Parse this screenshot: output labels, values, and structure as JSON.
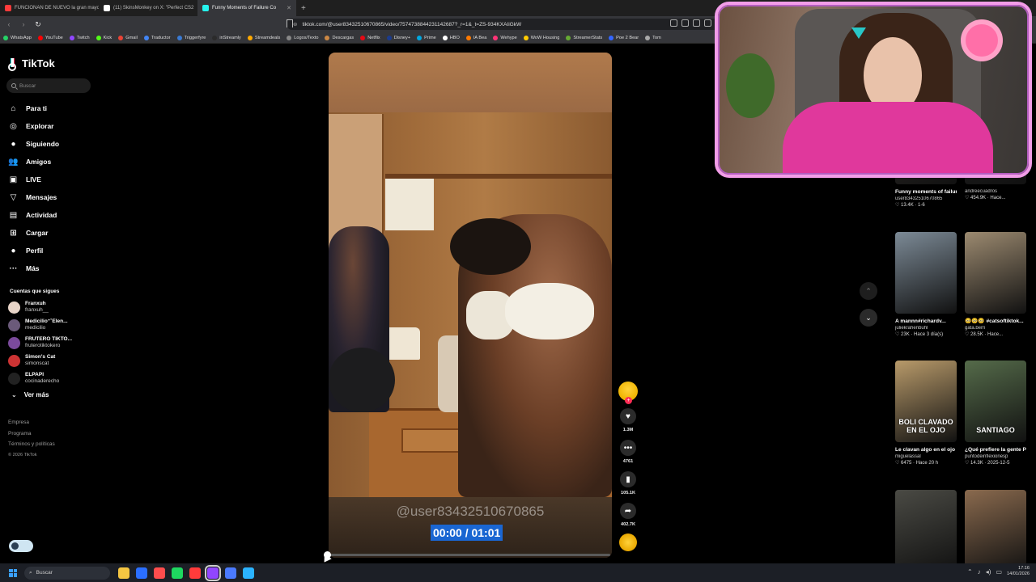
{
  "browser": {
    "tabs": [
      {
        "title": "FUNCIONAN DE NUEVO la gran mayor",
        "color": "#ff3b3b",
        "active": false
      },
      {
        "title": "(11) SkinsMonkey on X: \"Perfect CS2",
        "color": "#ffffff",
        "active": false
      },
      {
        "title": "Funny Moments of Failure Co",
        "color": "#25f4ee",
        "active": true
      }
    ],
    "new_tab": "+",
    "url": "tiktok.com/@user83432510670865/video/7574738844231142687?_r=1&_t=ZS-934KXAIiGkW",
    "bookmarks": [
      {
        "label": "WhatsApp",
        "color": "#25d366"
      },
      {
        "label": "YouTube",
        "color": "#ff0000"
      },
      {
        "label": "Twitch",
        "color": "#9146ff"
      },
      {
        "label": "Kick",
        "color": "#53fc18"
      },
      {
        "label": "Gmail",
        "color": "#ea4335"
      },
      {
        "label": "Traductor",
        "color": "#4285f4"
      },
      {
        "label": "Triggerfyre",
        "color": "#3a7bd5"
      },
      {
        "label": "inStreamly",
        "color": "#2b2b2b"
      },
      {
        "label": "Streamdeals",
        "color": "#ffaa00"
      },
      {
        "label": "Logos/Texto",
        "color": "#888888"
      },
      {
        "label": "Descargas",
        "color": "#cc8844"
      },
      {
        "label": "Netflix",
        "color": "#e50914"
      },
      {
        "label": "Disney+",
        "color": "#1a3b8e"
      },
      {
        "label": "Prime",
        "color": "#00a8e1"
      },
      {
        "label": "HBO",
        "color": "#ffffff"
      },
      {
        "label": "IA Bea",
        "color": "#ff7a00"
      },
      {
        "label": "Wehype",
        "color": "#ff3377"
      },
      {
        "label": "WoW Housing",
        "color": "#ffcc00"
      },
      {
        "label": "StreamerStats",
        "color": "#66aa33"
      },
      {
        "label": "Poe 2 Bear",
        "color": "#3366ff"
      },
      {
        "label": "Tom",
        "color": "#aaaaaa"
      }
    ]
  },
  "sidebar": {
    "logo": "TikTok",
    "search_placeholder": "Buscar",
    "nav": [
      {
        "label": "Para ti",
        "icon": "home-icon",
        "glyph": "⌂"
      },
      {
        "label": "Explorar",
        "icon": "compass-icon",
        "glyph": "◎"
      },
      {
        "label": "Siguiendo",
        "icon": "following-icon",
        "glyph": "●"
      },
      {
        "label": "Amigos",
        "icon": "friends-icon",
        "glyph": "👥"
      },
      {
        "label": "LIVE",
        "icon": "live-icon",
        "glyph": "▣"
      },
      {
        "label": "Mensajes",
        "icon": "messages-icon",
        "glyph": "▽"
      },
      {
        "label": "Actividad",
        "icon": "activity-icon",
        "glyph": "▤"
      },
      {
        "label": "Cargar",
        "icon": "upload-icon",
        "glyph": "⊞"
      },
      {
        "label": "Perfil",
        "icon": "profile-icon",
        "glyph": "●"
      },
      {
        "label": "Más",
        "icon": "more-icon",
        "glyph": "···"
      }
    ],
    "following_title": "Cuentas que sigues",
    "following": [
      {
        "name": "Franxuh",
        "handle": "franxuh__",
        "color": "#e8d5c8"
      },
      {
        "name": "Medicilio⁺˚Elen...",
        "handle": "medicilio",
        "color": "#6b5a7a"
      },
      {
        "name": "FRUTERO TIKTO...",
        "handle": "fruterotiktokero",
        "color": "#7b4a9c"
      },
      {
        "name": "Simon's Cat",
        "handle": "simonscat",
        "color": "#cc3333"
      },
      {
        "name": "ELPAPI",
        "handle": "cocinaderecho",
        "color": "#222222"
      }
    ],
    "ver_mas": "Ver más",
    "footer": [
      "Empresa",
      "Programa",
      "Términos y políticas"
    ],
    "copyright": "© 2026 TikTok"
  },
  "video": {
    "handle": "@user83432510670865",
    "time": "00:00 / 01:01",
    "progress": 0.0
  },
  "actions": {
    "likes": "1.3M",
    "comments": "4761",
    "saves": "105.1K",
    "shares": "402.7K"
  },
  "cards": [
    {
      "title": "Funny moments of failure #funny...",
      "author": "user83432510670865",
      "meta": "♡ 13.4K · 1-6",
      "thumb": "#3a3632",
      "thumb_text": ""
    },
    {
      "title": "",
      "author": "andreecuadros",
      "meta": "♡ 454.9K · Hace...",
      "thumb": "#2a2a2a",
      "thumb_text": ""
    },
    {
      "title": "A mannn#richardv...",
      "author": "juliekrahenbuhl",
      "meta": "♡ 23K · Hace 3 día(s)",
      "thumb": "#7c8a96",
      "thumb_text": ""
    },
    {
      "title": "🥺🥺🥺 #catsoftiktok...",
      "author": "gata.berri",
      "meta": "♡ 28.5K · Hace...",
      "thumb": "#9c8a70",
      "thumb_text": ""
    },
    {
      "title": "Le clavan algo en el ojo ....",
      "author": "miguelassal",
      "meta": "♡ 6475 · Hace 20 h",
      "thumb": "#b89a6a",
      "thumb_text": "BOLI CLAVADO EN EL OJO"
    },
    {
      "title": "¿Qué prefiere la gente Pedro...",
      "author": "puntodeinflexionesp",
      "meta": "♡ 14.3K · 2025-12-5",
      "thumb": "#556b4a",
      "thumb_text": "SANTIAGO"
    },
    {
      "title": "",
      "author": "",
      "meta": "",
      "thumb": "#4a4a44",
      "thumb_text": ""
    },
    {
      "title": "",
      "author": "",
      "meta": "",
      "thumb": "#8a6a4e",
      "thumb_text": ""
    }
  ],
  "taskbar": {
    "search": "Buscar",
    "apps": [
      "#f4c542",
      "#2b6fff",
      "#ff4d4d",
      "#1ed760",
      "#ff3b3b",
      "#9146ff",
      "#4a7aff",
      "#2bb3ff"
    ],
    "time": "17:16",
    "date": "14/01/2026"
  },
  "colors": {
    "accent": "#fe2c55",
    "tiktok_cyan": "#25f4ee",
    "cam_border": "#f29de8",
    "timestamp_highlight": "#1a66d2"
  }
}
